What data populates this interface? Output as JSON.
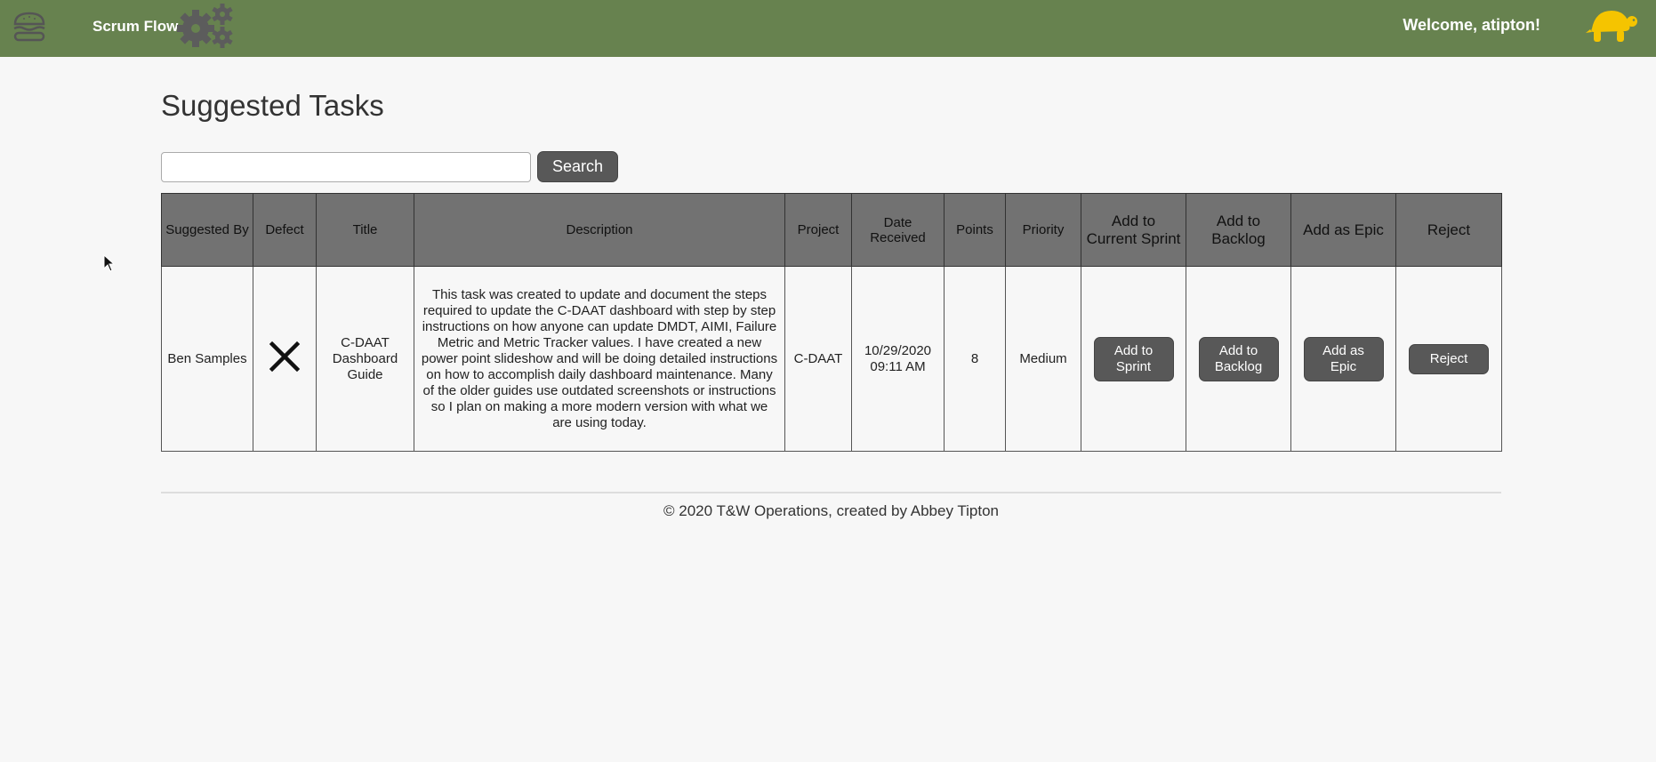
{
  "navbar": {
    "brand": "Scrum Flow",
    "welcome": "Welcome, atipton!",
    "menu_icon": "hamburger-icon",
    "logo_icon": "gears-icon",
    "avatar_icon": "turtle-icon",
    "color": "#67824f"
  },
  "page": {
    "title": "Suggested Tasks"
  },
  "search": {
    "value": "",
    "placeholder": "",
    "button_label": "Search"
  },
  "table": {
    "headers": [
      "Suggested By",
      "Defect",
      "Title",
      "Description",
      "Project",
      "Date Received",
      "Points",
      "Priority",
      "Add to Current Sprint",
      "Add to Backlog",
      "Add as Epic",
      "Reject"
    ],
    "rows": [
      {
        "suggested_by": "Ben Samples",
        "defect_icon": "x-icon",
        "title": "C-DAAT Dashboard Guide",
        "description": "This task was created to update and document the steps required to update the C-DAAT dashboard with step by step instructions on how anyone can update DMDT, AIMI, Failure Metric and Metric Tracker values.  I have created a new power point slideshow and will be doing detailed instructions on how to accomplish daily dashboard maintenance.  Many of the older guides use outdated screenshots or instructions so I plan on making a more modern version with what we are using today.",
        "project": "C-DAAT",
        "date_received": "10/29/2020 09:11 AM",
        "points": "8",
        "priority": "Medium",
        "add_sprint_label": "Add to Sprint",
        "add_backlog_label": "Add to Backlog",
        "add_epic_label": "Add as Epic",
        "reject_label": "Reject"
      }
    ]
  },
  "footer": {
    "text": "© 2020 T&W Operations, created by Abbey Tipton"
  },
  "colors": {
    "header_bg": "#727272",
    "button_bg": "#585858",
    "avatar": "#f5c400"
  }
}
